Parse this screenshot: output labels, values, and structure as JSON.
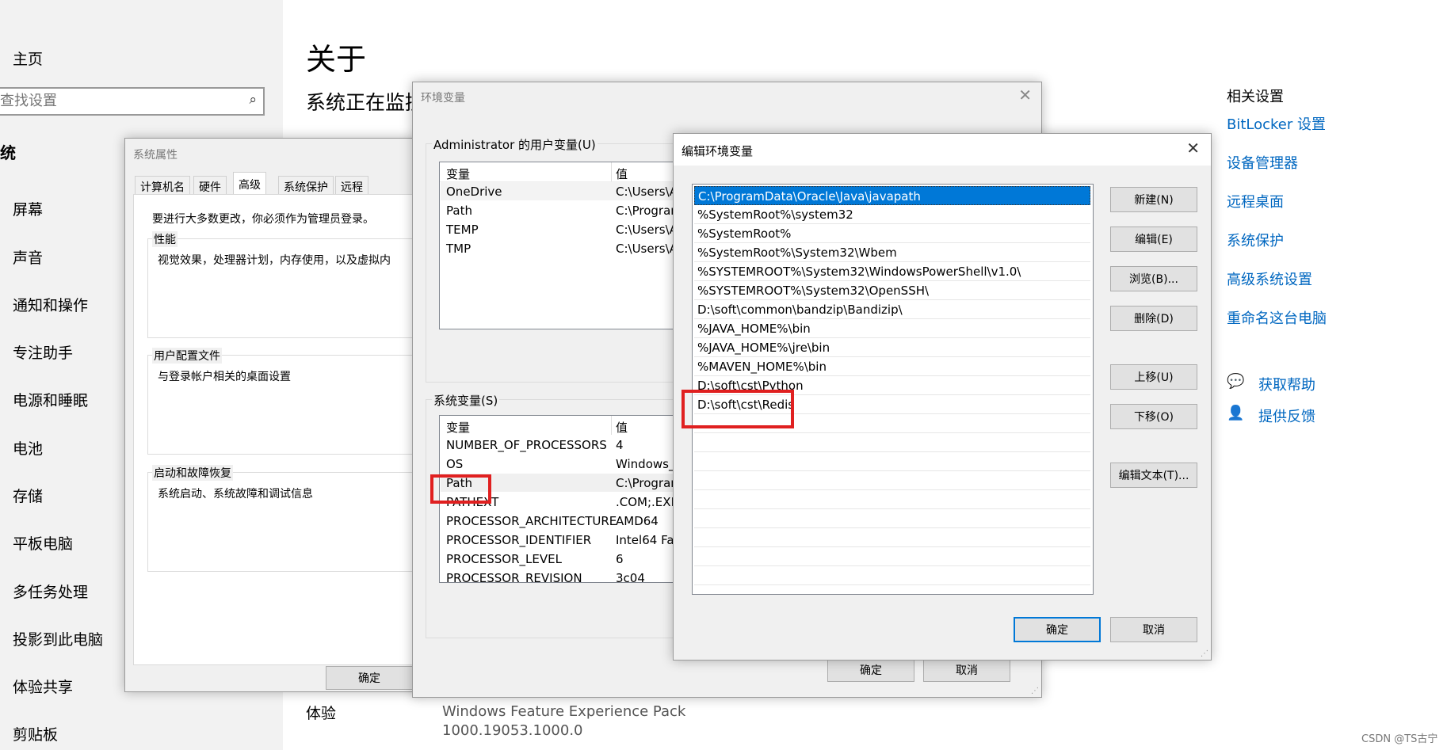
{
  "settings": {
    "home": "主页",
    "search_placeholder": "查找设置",
    "section": "统",
    "nav_items": [
      "屏幕",
      "声音",
      "通知和操作",
      "专注助手",
      "电源和睡眠",
      "电池",
      "存储",
      "平板电脑",
      "多任务处理",
      "投影到此电脑",
      "体验共享",
      "剪贴板"
    ],
    "about_title": "关于",
    "about_subtitle": "系统正在监控",
    "experience_label": "体验",
    "experience_value": "Windows Feature Experience Pack",
    "experience_version": "1000.19053.1000.0",
    "related_title": "相关设置",
    "related_links": [
      "BitLocker 设置",
      "设备管理器",
      "远程桌面",
      "系统保护",
      "高级系统设置",
      "重命名这台电脑"
    ],
    "get_help": "获取帮助",
    "give_feedback": "提供反馈",
    "watermark": "CSDN @TS古宁"
  },
  "system_properties": {
    "title": "系统属性",
    "tabs": [
      "计算机名",
      "硬件",
      "高级",
      "系统保护",
      "远程"
    ],
    "admin_note": "要进行大多数更改，你必须作为管理员登录。",
    "performance_label": "性能",
    "performance_desc": "视觉效果，处理器计划，内存使用，以及虚拟内",
    "profile_label": "用户配置文件",
    "profile_desc": "与登录帐户相关的桌面设置",
    "startup_label": "启动和故障恢复",
    "startup_desc": "系统启动、系统故障和调试信息",
    "ok": "确定"
  },
  "env_vars": {
    "title": "环境变量",
    "user_group": "Administrator 的用户变量(U)",
    "col_var": "变量",
    "col_val": "值",
    "user_rows": [
      {
        "name": "OneDrive",
        "value": "C:\\Users\\A"
      },
      {
        "name": "Path",
        "value": "C:\\Program"
      },
      {
        "name": "TEMP",
        "value": "C:\\Users\\A"
      },
      {
        "name": "TMP",
        "value": "C:\\Users\\A"
      }
    ],
    "sys_group": "系统变量(S)",
    "sys_rows": [
      {
        "name": "NUMBER_OF_PROCESSORS",
        "value": "4"
      },
      {
        "name": "OS",
        "value": "Windows_"
      },
      {
        "name": "Path",
        "value": "C:\\Progran"
      },
      {
        "name": "PATHEXT",
        "value": ".COM;.EXE"
      },
      {
        "name": "PROCESSOR_ARCHITECTURE",
        "value": "AMD64"
      },
      {
        "name": "PROCESSOR_IDENTIFIER",
        "value": "Intel64 Fa"
      },
      {
        "name": "PROCESSOR_LEVEL",
        "value": "6"
      },
      {
        "name": "PROCESSOR_REVISION",
        "value": "3c04"
      }
    ],
    "ok": "确定",
    "cancel": "取消"
  },
  "edit_env": {
    "title": "编辑环境变量",
    "entries": [
      "C:\\ProgramData\\Oracle\\Java\\javapath",
      "%SystemRoot%\\system32",
      "%SystemRoot%",
      "%SystemRoot%\\System32\\Wbem",
      "%SYSTEMROOT%\\System32\\WindowsPowerShell\\v1.0\\",
      "%SYSTEMROOT%\\System32\\OpenSSH\\",
      "D:\\soft\\common\\bandzip\\Bandizip\\",
      "%JAVA_HOME%\\bin",
      "%JAVA_HOME%\\jre\\bin",
      "%MAVEN_HOME%\\bin",
      "D:\\soft\\cst\\Python",
      "D:\\soft\\cst\\Redis"
    ],
    "buttons": {
      "new": "新建(N)",
      "edit": "编辑(E)",
      "browse": "浏览(B)...",
      "delete": "删除(D)",
      "up": "上移(U)",
      "down": "下移(O)",
      "edit_text": "编辑文本(T)...",
      "ok": "确定",
      "cancel": "取消"
    }
  },
  "colors": {
    "accent": "#0078d7",
    "link": "#0067c0",
    "highlight": "#e02020"
  }
}
